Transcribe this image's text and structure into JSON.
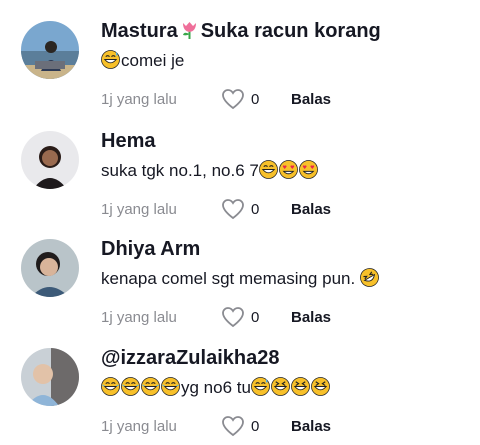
{
  "comments": [
    {
      "username_part1": "Mastura",
      "username_icon": "tulip-icon",
      "username_part2": "Suka racun korang",
      "text_emoji_before": [
        "grin-sweat-emoji"
      ],
      "text": "comei je",
      "text_emoji_after": [],
      "time": "1j yang lalu",
      "likes": "0",
      "reply_label": "Balas"
    },
    {
      "username_part1": "Hema",
      "text_emoji_before": [],
      "text": "suka tgk no.1, no.6 7",
      "text_emoji_after": [
        "grin-emoji",
        "heart-eyes-emoji",
        "heart-eyes-emoji"
      ],
      "time": "1j yang lalu",
      "likes": "0",
      "reply_label": "Balas"
    },
    {
      "username_part1": "Dhiya Arm",
      "text_emoji_before": [],
      "text": "kenapa comel sgt memasing pun. ",
      "text_emoji_after": [
        "rofl-emoji"
      ],
      "time": "1j yang lalu",
      "likes": "0",
      "reply_label": "Balas"
    },
    {
      "username_part1": "@izzaraZulaikha28",
      "text_emoji_before": [
        "joy-emoji",
        "joy-emoji",
        "joy-emoji",
        "joy-emoji"
      ],
      "text": "yg no6 tu",
      "text_emoji_after": [
        "grin-sweat-emoji",
        "squint-laugh-emoji",
        "squint-laugh-emoji",
        "squint-laugh-emoji"
      ],
      "time": "1j yang lalu",
      "likes": "0",
      "reply_label": "Balas"
    }
  ],
  "colors": {
    "meta_gray": "#8a8b91",
    "text_dark": "#161823",
    "emoji_yellow": "#f7c02a"
  }
}
